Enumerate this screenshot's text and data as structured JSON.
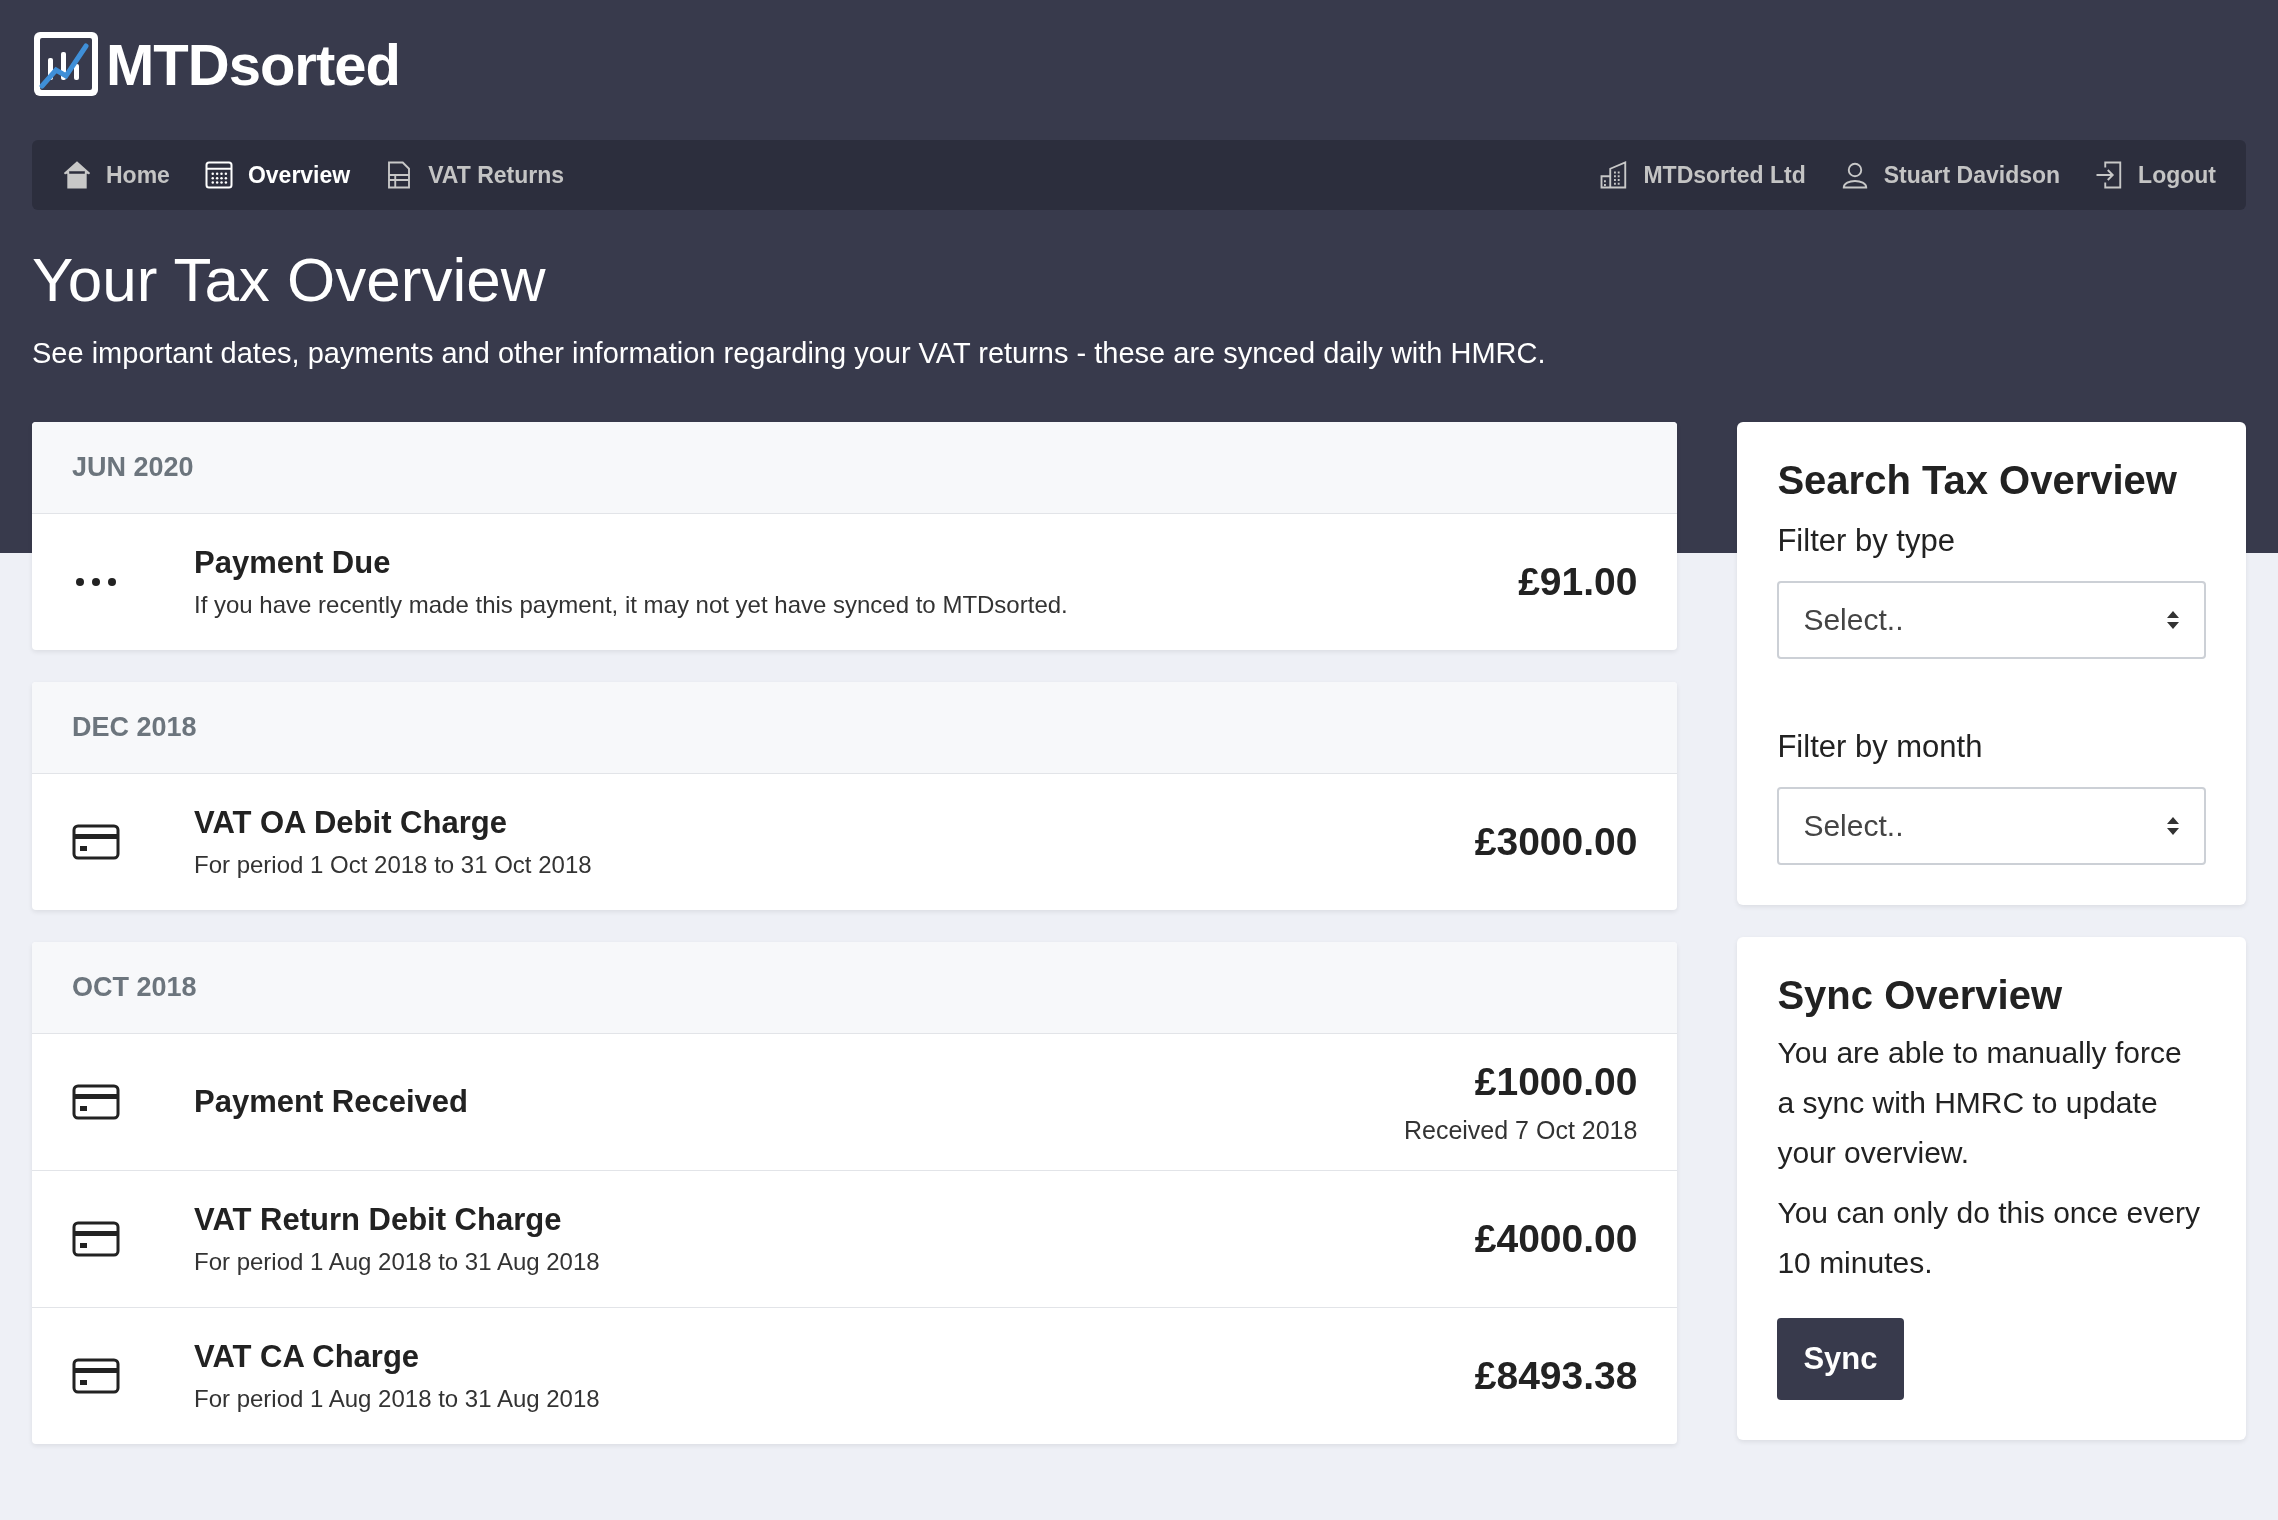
{
  "brand": {
    "name": "MTDsorted"
  },
  "nav": {
    "left": [
      {
        "label": "Home",
        "kind": "home",
        "selected": false
      },
      {
        "label": "Overview",
        "kind": "calendar",
        "selected": true
      },
      {
        "label": "VAT Returns",
        "kind": "document",
        "selected": false
      }
    ],
    "right": [
      {
        "label": "MTDsorted Ltd",
        "kind": "building"
      },
      {
        "label": "Stuart Davidson",
        "kind": "user"
      },
      {
        "label": "Logout",
        "kind": "logout"
      }
    ]
  },
  "page": {
    "title": "Your Tax Overview",
    "subtitle": "See important dates, payments and other information regarding your VAT returns - these are synced daily with HMRC."
  },
  "groups": [
    {
      "month": "JUN 2020",
      "items": [
        {
          "kind": "pending",
          "title": "Payment Due",
          "detail": "If you have recently made this payment, it may not yet have synced to MTDsorted.",
          "amount": "£91.00"
        }
      ]
    },
    {
      "month": "DEC 2018",
      "items": [
        {
          "kind": "card",
          "title": "VAT OA Debit Charge",
          "detail": "For period 1 Oct 2018 to 31 Oct 2018",
          "amount": "£3000.00"
        }
      ]
    },
    {
      "month": "OCT 2018",
      "items": [
        {
          "kind": "card",
          "title": "Payment Received",
          "amount": "£1000.00",
          "note": "Received 7 Oct 2018"
        },
        {
          "kind": "card",
          "title": "VAT Return Debit Charge",
          "detail": "For period 1 Aug 2018 to 31 Aug 2018",
          "amount": "£4000.00"
        },
        {
          "kind": "card",
          "title": "VAT CA Charge",
          "detail": "For period 1 Aug 2018 to 31 Aug 2018",
          "amount": "£8493.38"
        }
      ]
    }
  ],
  "search": {
    "title": "Search Tax Overview",
    "filters": [
      {
        "label": "Filter by type",
        "value": "Select.."
      },
      {
        "label": "Filter by month",
        "value": "Select.."
      }
    ]
  },
  "sync": {
    "title": "Sync Overview",
    "lines": [
      "You are able to manually force a sync with HMRC to update your overview.",
      "You can only do this once every 10 minutes."
    ],
    "button": "Sync"
  }
}
